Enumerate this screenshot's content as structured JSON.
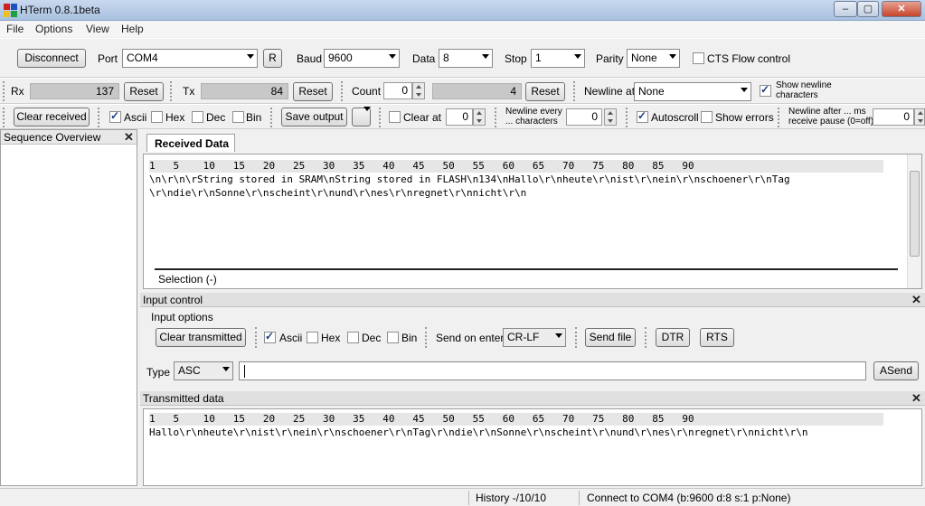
{
  "window": {
    "title": "HTerm 0.8.1beta",
    "min": "–",
    "max": "▢",
    "close": "✕"
  },
  "menu": [
    "File",
    "Options",
    "View",
    "Help"
  ],
  "connection": {
    "disconnect_label": "Disconnect",
    "port_label": "Port",
    "port_value": "COM4",
    "refresh_label": "R",
    "baud_label": "Baud",
    "baud_value": "9600",
    "data_label": "Data",
    "data_value": "8",
    "stop_label": "Stop",
    "stop_value": "1",
    "parity_label": "Parity",
    "parity_value": "None",
    "cts_label": "CTS Flow control"
  },
  "counters": {
    "rx_label": "Rx",
    "rx_value": "137",
    "rx_reset": "Reset",
    "tx_label": "Tx",
    "tx_value": "84",
    "tx_reset": "Reset",
    "count_label": "Count",
    "count_input": "0",
    "count_value": "4",
    "count_reset": "Reset",
    "newline_at_label": "Newline at",
    "newline_at_value": "None",
    "show_newline_line1": "Show newline",
    "show_newline_line2": "characters"
  },
  "display": {
    "clear_received": "Clear received",
    "ascii": "Ascii",
    "hex": "Hex",
    "dec": "Dec",
    "bin": "Bin",
    "save_output": "Save output",
    "clear_at": "Clear at",
    "clear_at_value": "0",
    "newline_every_1": "Newline every",
    "newline_every_2": "... characters",
    "newline_every_value": "0",
    "autoscroll": "Autoscroll",
    "show_errors": "Show errors",
    "newline_after_1": "Newline after ... ms",
    "newline_after_2": "receive pause (0=off)",
    "newline_after_value": "0"
  },
  "sequence": {
    "title": "Sequence Overview"
  },
  "received": {
    "tab_label": "Received Data",
    "ruler": "1   5    10   15   20   25   30   35   40   45   50   55   60   65   70   75   80   85   90",
    "line1": "\\n\\r\\n\\rString stored in SRAM\\nString stored in FLASH\\n134\\nHallo\\r\\nheute\\r\\nist\\r\\nein\\r\\nschoener\\r\\nTag",
    "line2": "\\r\\ndie\\r\\nSonne\\r\\nscheint\\r\\nund\\r\\nes\\r\\nregnet\\r\\nnicht\\r\\n",
    "selection": "Selection (-)"
  },
  "input_control": {
    "title": "Input control",
    "options_label": "Input options",
    "clear_transmitted": "Clear transmitted",
    "ascii": "Ascii",
    "hex": "Hex",
    "dec": "Dec",
    "bin": "Bin",
    "send_on_enter_label": "Send on enter",
    "send_on_enter_value": "CR-LF",
    "send_file": "Send file",
    "dtr": "DTR",
    "rts": "RTS",
    "type_label": "Type",
    "type_value": "ASC",
    "input_value": "",
    "asend": "ASend"
  },
  "transmitted": {
    "title": "Transmitted data",
    "ruler": "1   5    10   15   20   25   30   35   40   45   50   55   60   65   70   75   80   85   90",
    "line1": "Hallo\\r\\nheute\\r\\nist\\r\\nein\\r\\nschoener\\r\\nTag\\r\\ndie\\r\\nSonne\\r\\nscheint\\r\\nund\\r\\nes\\r\\nregnet\\r\\nnicht\\r\\n"
  },
  "status": {
    "history": "History -/10/10",
    "connection": "Connect to COM4 (b:9600 d:8 s:1 p:None)"
  }
}
